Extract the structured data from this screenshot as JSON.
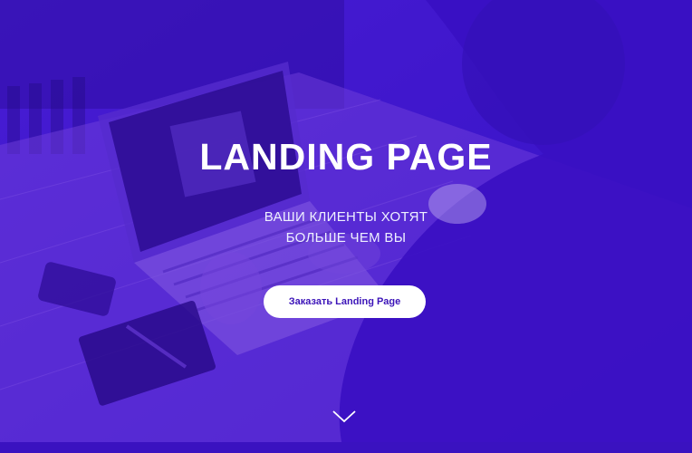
{
  "hero": {
    "title": "LANDING PAGE",
    "subtitle_line1": "ВАШИ КЛИЕНТЫ ХОТЯТ",
    "subtitle_line2": "БОЛЬШЕ ЧЕМ ВЫ",
    "cta_label": "Заказать Landing Page",
    "scroll_icon": "chevron-down-icon",
    "background_image": "laptop-on-wooden-table-photo",
    "overlay_color": "#3a0fc9"
  },
  "colors": {
    "overlay": "#3a0fc9",
    "button_bg": "#ffffff",
    "button_text": "#3b13b8",
    "title_text": "#ffffff"
  }
}
